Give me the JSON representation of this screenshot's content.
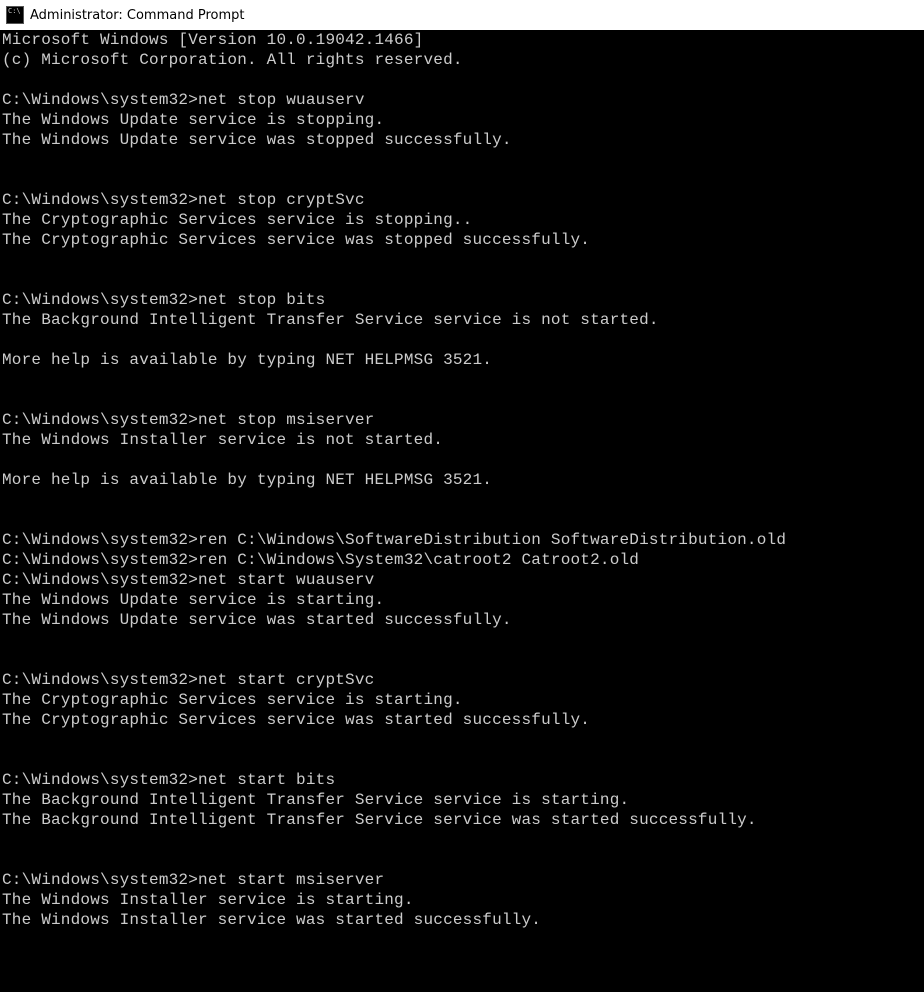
{
  "window": {
    "title": "Administrator: Command Prompt"
  },
  "terminal": {
    "prompt": "C:\\Windows\\system32>",
    "header1": "Microsoft Windows [Version 10.0.19042.1466]",
    "header2": "(c) Microsoft Corporation. All rights reserved.",
    "blocks": [
      {
        "cmd": "net stop wuauserv",
        "out": "The Windows Update service is stopping.\nThe Windows Update service was stopped successfully.\n"
      },
      {
        "cmd": "net stop cryptSvc",
        "out": "The Cryptographic Services service is stopping..\nThe Cryptographic Services service was stopped successfully.\n"
      },
      {
        "cmd": "net stop bits",
        "out": "The Background Intelligent Transfer Service service is not started.\n\nMore help is available by typing NET HELPMSG 3521.\n"
      },
      {
        "cmd": "net stop msiserver",
        "out": "The Windows Installer service is not started.\n\nMore help is available by typing NET HELPMSG 3521.\n"
      },
      {
        "cmd": "ren C:\\Windows\\SoftwareDistribution SoftwareDistribution.old",
        "out": ""
      },
      {
        "cmd": "ren C:\\Windows\\System32\\catroot2 Catroot2.old",
        "out": ""
      },
      {
        "cmd": "net start wuauserv",
        "out": "The Windows Update service is starting.\nThe Windows Update service was started successfully.\n"
      },
      {
        "cmd": "net start cryptSvc",
        "out": "The Cryptographic Services service is starting.\nThe Cryptographic Services service was started successfully.\n"
      },
      {
        "cmd": "net start bits",
        "out": "The Background Intelligent Transfer Service service is starting.\nThe Background Intelligent Transfer Service service was started successfully.\n"
      },
      {
        "cmd": "net start msiserver",
        "out": "The Windows Installer service is starting.\nThe Windows Installer service was started successfully.\n"
      }
    ]
  }
}
